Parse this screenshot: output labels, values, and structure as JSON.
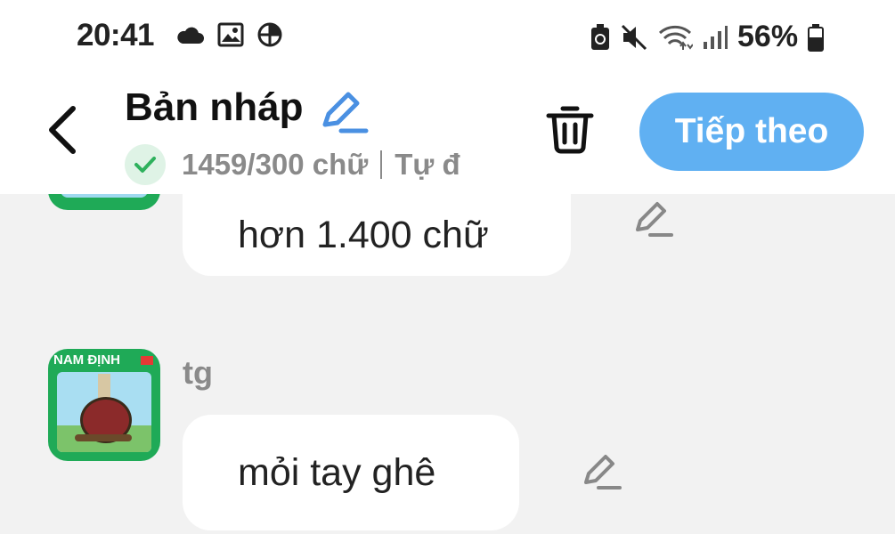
{
  "status_bar": {
    "time": "20:41",
    "battery_percent": "56%",
    "left_icons": [
      "cloud-icon",
      "image-icon",
      "vpn-icon"
    ],
    "right_icons": [
      "battery-saver-icon",
      "mute-icon",
      "wifi-icon",
      "signal-icon",
      "battery-icon"
    ]
  },
  "header": {
    "title": "Bản nháp",
    "word_count": "1459/300 chữ",
    "autosave": "Tự đ",
    "next_label": "Tiếp theo",
    "accent_color": "#60b0f2",
    "check_color": "#2eb15d"
  },
  "messages": [
    {
      "sender": "",
      "text": "hơn 1.400 chữ"
    },
    {
      "sender": "tg",
      "text": "mỏi tay ghê",
      "avatar_text": "NAM ĐỊNH"
    }
  ]
}
